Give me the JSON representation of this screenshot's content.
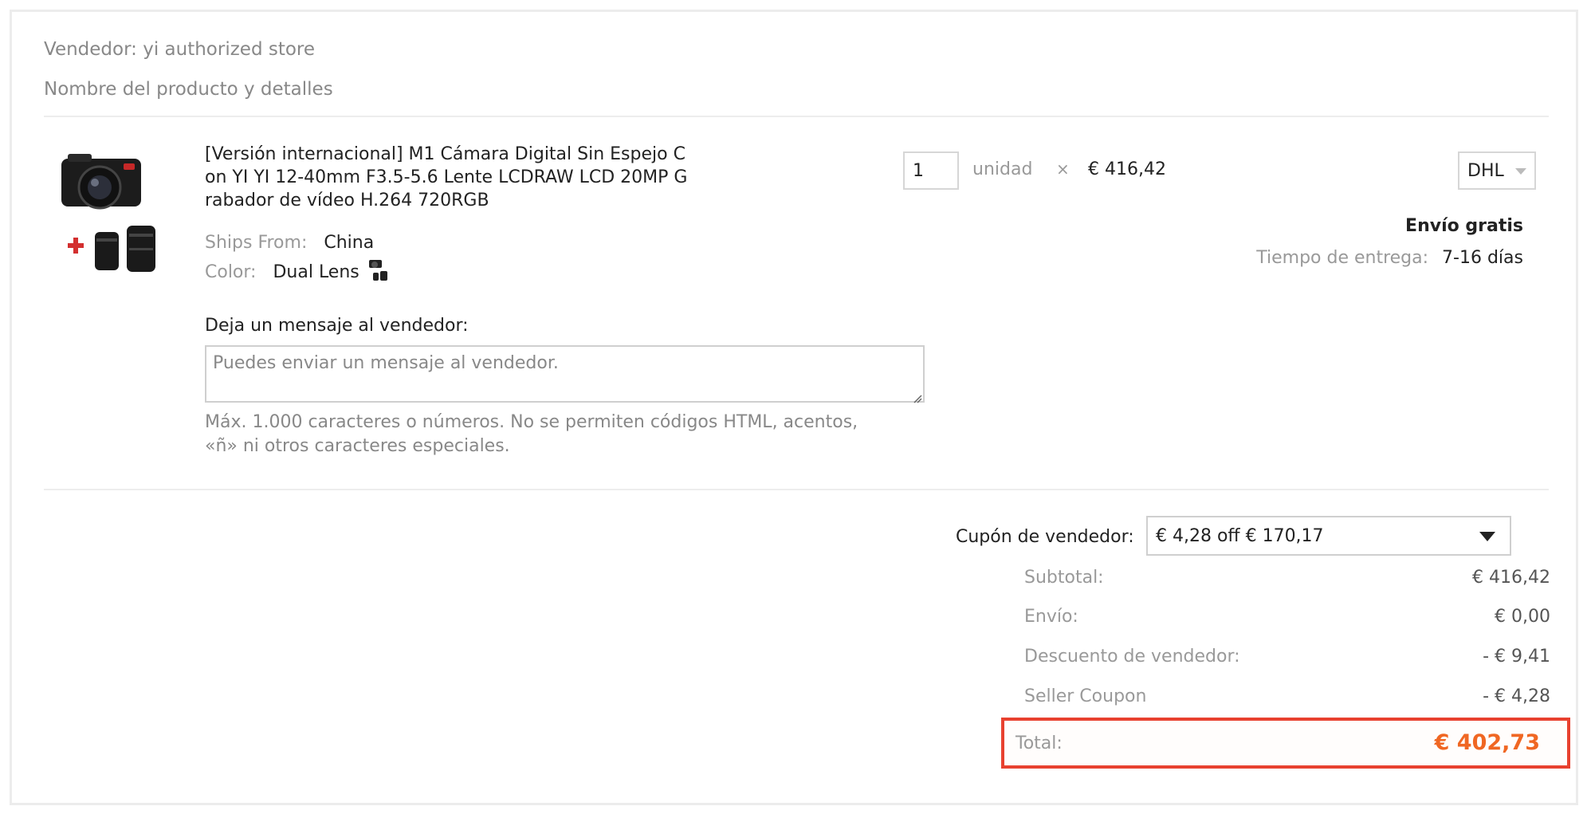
{
  "seller": {
    "label": "Vendedor:",
    "name": "yi authorized store"
  },
  "product_header": "Nombre del producto y detalles",
  "product": {
    "title_lines": [
      "[Versión internacional] M1 Cámara Digital Sin Espejo C",
      "on YI YI 12-40mm F3.5-5.6 Lente LCDRAW LCD 20MP G",
      "rabador de vídeo H.264 720RGB"
    ],
    "ships_from_label": "Ships From:",
    "ships_from_value": "China",
    "color_label": "Color:",
    "color_value": "Dual Lens",
    "image_icon": "camera-with-lenses",
    "quantity": "1",
    "unit_label": "unidad",
    "times": "×",
    "unit_price": "€ 416,42"
  },
  "message": {
    "label": "Deja un mensaje al vendedor:",
    "placeholder": "Puedes enviar un mensaje al vendedor.",
    "hint_lines": [
      "Máx. 1.000 caracteres o números. No se permiten códigos HTML, acentos,",
      "«ñ» ni otros caracteres especiales."
    ]
  },
  "shipping": {
    "method": "DHL",
    "free_label": "Envío gratis",
    "delivery_label": "Tiempo de entrega:",
    "delivery_value": "7-16 días"
  },
  "coupon": {
    "label": "Cupón de vendedor:",
    "selected": "€ 4,28 off € 170,17"
  },
  "summary": {
    "subtotal_label": "Subtotal:",
    "subtotal": "€ 416,42",
    "shipping_label": "Envío:",
    "shipping": "€ 0,00",
    "discount_label": "Descuento de vendedor:",
    "discount": "- € 9,41",
    "seller_coupon_label": "Seller Coupon",
    "seller_coupon": "- € 4,28",
    "total_label": "Total:",
    "total": "€ 402,73"
  },
  "colors": {
    "total_accent": "#f06723",
    "highlight_border": "#e8412f"
  }
}
